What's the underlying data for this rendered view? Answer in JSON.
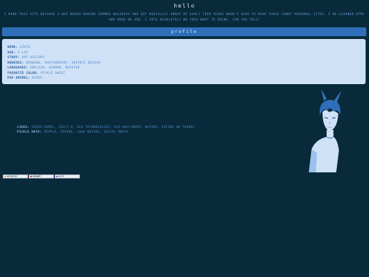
{
  "page": {
    "title": "hello",
    "intro": "i made this site because i was bored during summer holidays and got nostalgic about my early teen years when i used to have those funky personal sites. i re-learned html and here we are. i arte resolutely no idea what to doing. can you tell?"
  },
  "profile": {
    "header": "profile",
    "fields": [
      {
        "key": "name:",
        "value": "ezhte"
      },
      {
        "key": "age:",
        "value": "a lot"
      },
      {
        "key": "study:",
        "value": "art history"
      },
      {
        "key": "hobbies:",
        "value": "drawing, photography, graphic design"
      },
      {
        "key": "languages:",
        "value": "english, german, russian"
      },
      {
        "key": "favorite color:",
        "value": "pickle sweet"
      },
      {
        "key": "fav animal:",
        "value": "birds"
      }
    ]
  },
  "likes": [
    {
      "key": "likes:",
      "value": "video games, jelly-o, old technologies, old hollywood, nature, eating on things"
    },
    {
      "key": "pickle hate:",
      "value": "people, spoons, loud noises, social media"
    }
  ],
  "badges": [
    {
      "label": "autoplay",
      "color": "#e9a23b"
    },
    {
      "label": "webamp",
      "color": "#d9342b"
    },
    {
      "label": "gifs",
      "color": "#8a4fd1"
    }
  ],
  "colors": {
    "background": "#082a3a",
    "header": "#2f6fb9",
    "panel": "#cfe1f7",
    "accent": "#6fa3df"
  }
}
